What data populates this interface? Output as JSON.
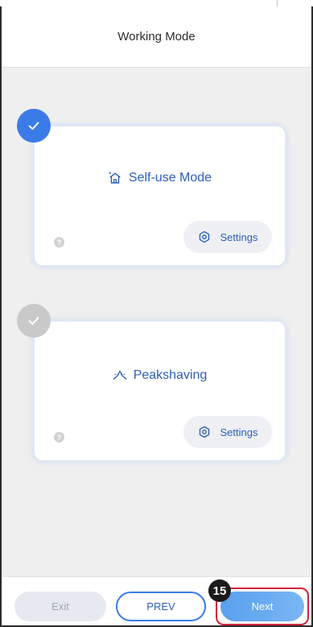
{
  "header": {
    "title": "Working Mode"
  },
  "modes": [
    {
      "label": "Self-use Mode",
      "icon": "house-sparkle-icon",
      "selected": true,
      "settings_label": "Settings",
      "help_glyph": "?"
    },
    {
      "label": "Peakshaving",
      "icon": "peak-chart-icon",
      "selected": false,
      "settings_label": "Settings",
      "help_glyph": "?"
    }
  ],
  "footer": {
    "exit_label": "Exit",
    "prev_label": "PREV",
    "next_label": "Next",
    "step_badge": "15"
  },
  "colors": {
    "accent": "#3b7be8",
    "text_blue": "#2b5fb8",
    "inactive_check": "#c9c9c9",
    "highlight": "#d2243b"
  }
}
